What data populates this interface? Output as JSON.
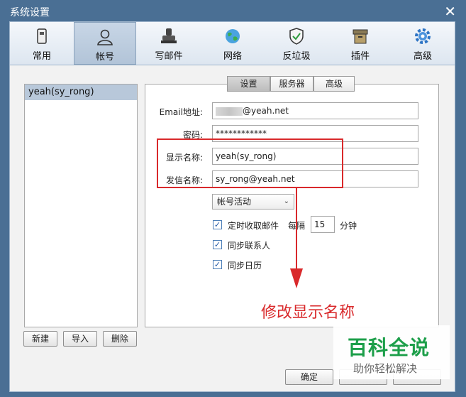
{
  "window": {
    "title": "系统设置",
    "close_glyph": "✕"
  },
  "toolbar": {
    "items": [
      {
        "label": "常用",
        "icon": "general-icon"
      },
      {
        "label": "帐号",
        "icon": "account-icon"
      },
      {
        "label": "写邮件",
        "icon": "compose-icon"
      },
      {
        "label": "网络",
        "icon": "network-icon"
      },
      {
        "label": "反垃圾",
        "icon": "antispam-icon"
      },
      {
        "label": "插件",
        "icon": "plugin-icon"
      },
      {
        "label": "高级",
        "icon": "advanced-icon"
      }
    ],
    "active": "帐号"
  },
  "accounts": {
    "items": [
      "yeah(sy_rong)"
    ],
    "selected": "yeah(sy_rong)"
  },
  "account_buttons": {
    "new": "新建",
    "import": "导入",
    "delete": "删除"
  },
  "tabs": {
    "items": [
      "设置",
      "服务器",
      "高级"
    ],
    "active": "设置"
  },
  "form": {
    "email_label": "Email地址:",
    "email_value": "@yeah.net",
    "password_label": "密码:",
    "password_value": "************",
    "display_name_label": "显示名称:",
    "display_name_value": "yeah(sy_rong)",
    "sender_name_label": "发信名称:",
    "sender_name_value": "sy_rong@yeah.net",
    "activity_select": "帐号活动",
    "auto_receive_label": "定时收取邮件",
    "auto_receive_checked": true,
    "interval_label": "每隔",
    "interval_value": "15",
    "interval_unit": "分钟",
    "sync_contacts_label": "同步联系人",
    "sync_contacts_checked": true,
    "sync_calendar_label": "同步日历",
    "sync_calendar_checked": true
  },
  "footer": {
    "ok_label": "确定"
  },
  "annotation": {
    "text": "修改显示名称",
    "color": "#d9292b"
  },
  "watermark": {
    "main": "百科全说",
    "sub": "助你轻松解决",
    "color": "#1d9f4a"
  }
}
